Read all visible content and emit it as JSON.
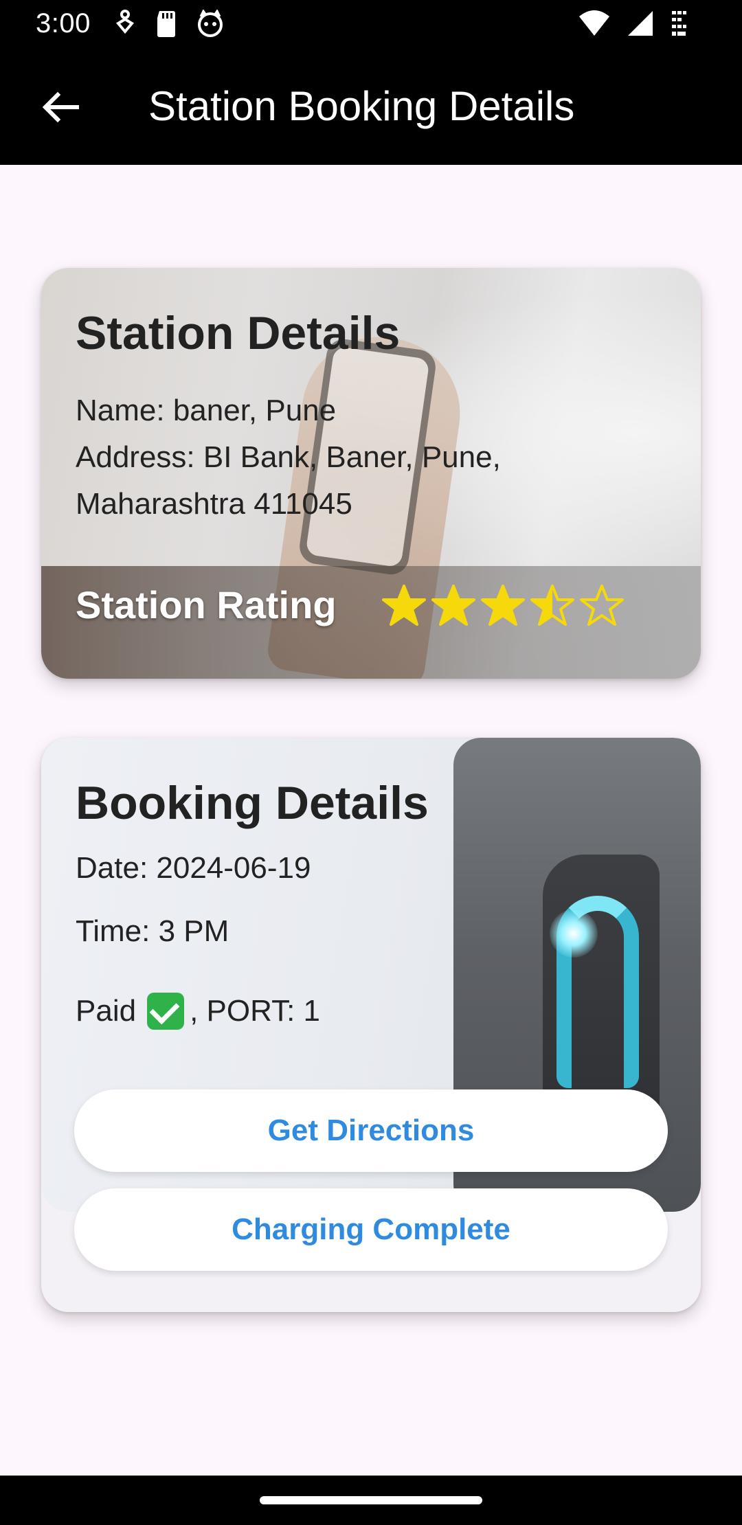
{
  "status_bar": {
    "time": "3:00",
    "left_icons": [
      "accessibility-icon",
      "sd-card-icon",
      "cat-face-icon"
    ],
    "right_icons": [
      "wifi-icon",
      "signal-icon",
      "battery-icon"
    ]
  },
  "app_bar": {
    "title": "Station Booking Details",
    "back_icon": "arrow-left-icon"
  },
  "station_card": {
    "title": "Station Details",
    "name": "Name: baner, Pune",
    "address_line1": "Address: BI Bank, Baner, Pune,",
    "address_line2": "Maharashtra 411045",
    "rating_label": "Station Rating",
    "rating_value": 3.5,
    "rating_max": 5,
    "star_color": "#f5d90a"
  },
  "booking_card": {
    "title": "Booking Details",
    "date": "Date: 2024-06-19",
    "time": "Time: 3 PM",
    "paid_prefix": "Paid",
    "paid_suffix": ", PORT: 1",
    "check_icon": "check-badge-icon",
    "get_directions_label": "Get Directions",
    "charging_complete_label": "Charging Complete",
    "button_text_color": "#2f8be0"
  }
}
